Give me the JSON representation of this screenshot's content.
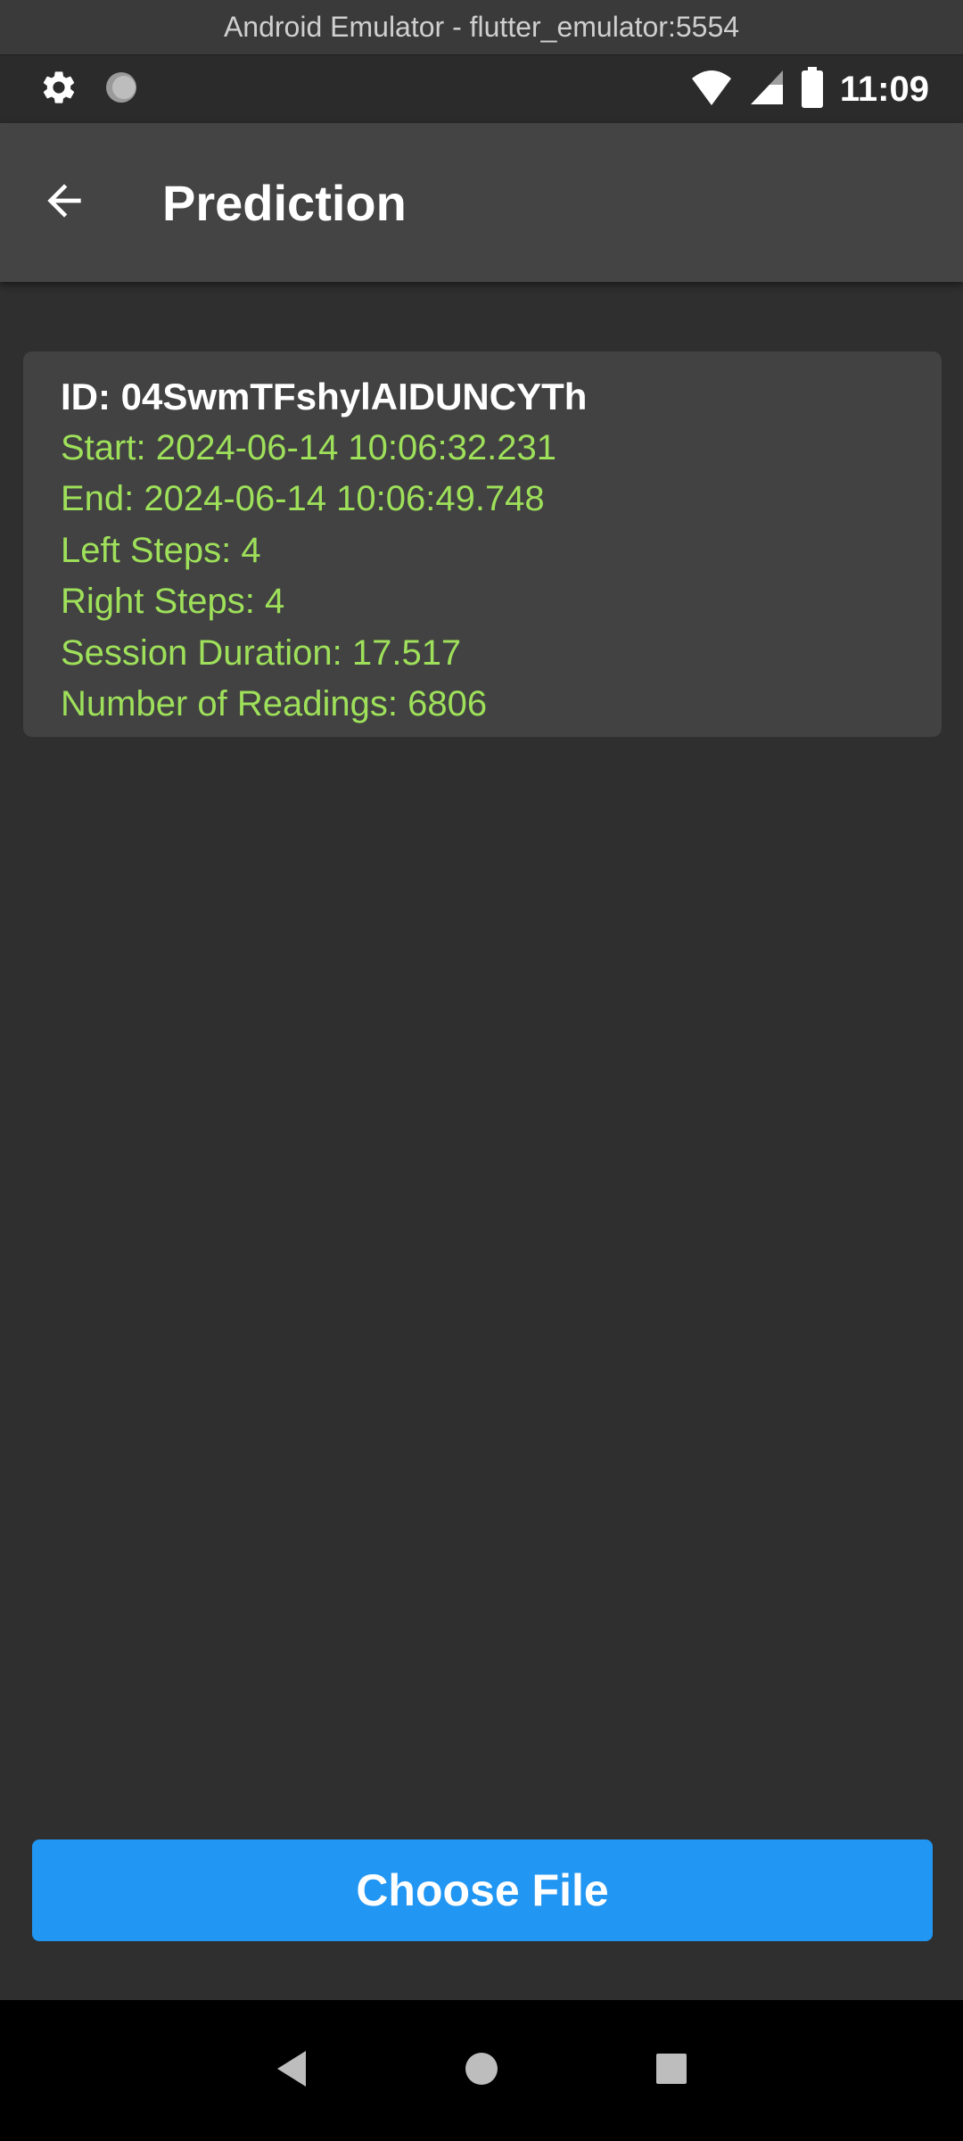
{
  "window": {
    "title": "Android Emulator - flutter_emulator:5554"
  },
  "status_bar": {
    "time": "11:09",
    "left_icons": [
      "settings-gear-icon",
      "circle-notification-icon"
    ],
    "right_icons": [
      "wifi-icon",
      "cellular-signal-icon",
      "battery-icon"
    ]
  },
  "app_bar": {
    "title": "Prediction",
    "back_icon": "arrow-back-icon"
  },
  "card": {
    "id_line": "ID: 04SwmTFshylAIDUNCYTh",
    "start": "Start: 2024-06-14 10:06:32.231",
    "end": "End: 2024-06-14 10:06:49.748",
    "left_steps": "Left Steps: 4",
    "right_steps": "Right Steps: 4",
    "session_duration": "Session Duration: 17.517",
    "readings": "Number of Readings: 6806"
  },
  "actions": {
    "choose_file_label": "Choose File"
  },
  "colors": {
    "accent_green": "#9ee05a",
    "button_blue": "#2196f3",
    "background": "#2f2f2f",
    "app_bar": "#444444"
  }
}
